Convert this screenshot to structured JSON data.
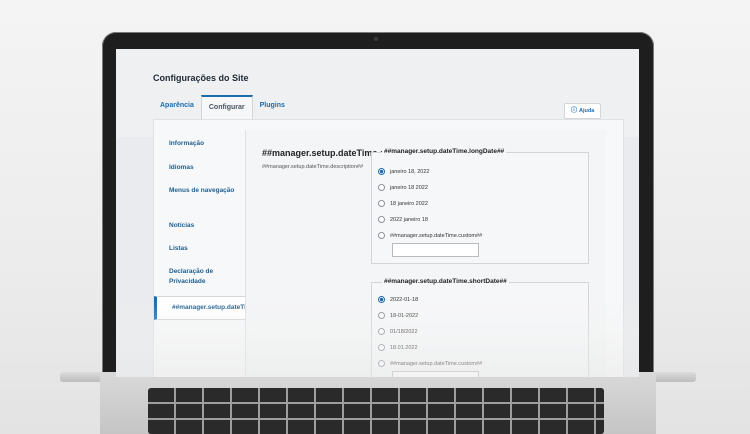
{
  "header": {
    "title": "Configurações do Site",
    "tabs": [
      {
        "label": "Aparência"
      },
      {
        "label": "Configurar"
      },
      {
        "label": "Plugins"
      }
    ],
    "help_label": "Ajuda"
  },
  "sidebar": {
    "items": [
      {
        "label": "Informação"
      },
      {
        "label": "Idiomas"
      },
      {
        "label": "Menus de navegação"
      },
      {
        "label": "Notícias"
      },
      {
        "label": "Listas"
      },
      {
        "label": "Declaração de Privacidade"
      },
      {
        "label": "##manager.setup.dateTime##"
      }
    ]
  },
  "main": {
    "title": "##manager.setup.dateTime.descriptionTitle##",
    "description": "##manager.setup.dateTime.description##",
    "long_date": {
      "legend": "##manager.setup.dateTime.longDate##",
      "options": [
        "janeiro 18, 2022",
        "janeiro 18 2022",
        "18 janeiro 2022",
        "2022 janeiro 18",
        "##manager.setup.dateTime.custom##"
      ],
      "selected": "janeiro 18, 2022"
    },
    "short_date": {
      "legend": "##manager.setup.dateTime.shortDate##",
      "options": [
        "2022-01-18",
        "18-01-2022",
        "01/18/2022",
        "18.01.2022",
        "##manager.setup.dateTime.custom##"
      ],
      "selected": "2022-01-18"
    }
  },
  "colors": {
    "accent": "#1e6bab",
    "text": "#1f2a36"
  }
}
